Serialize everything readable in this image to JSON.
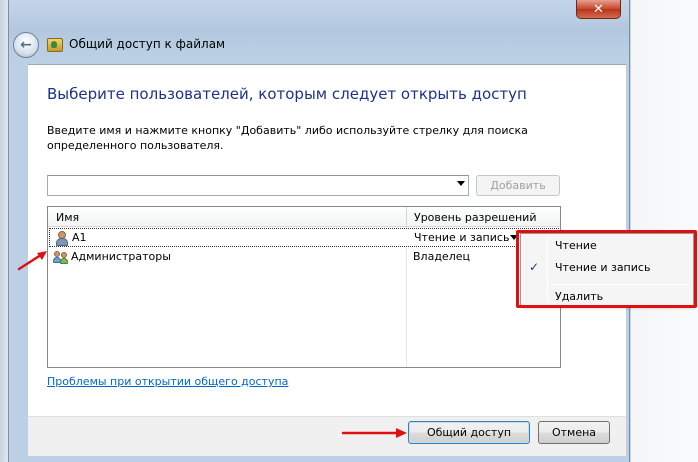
{
  "window": {
    "title": "Общий доступ к файлам",
    "close_label": "✕"
  },
  "main": {
    "heading": "Выберите пользователей, которым следует открыть доступ",
    "instruction": "Введите имя и нажмите кнопку \"Добавить\" либо используйте стрелку для поиска определенного пользователя.",
    "name_input_value": "",
    "add_button": "Добавить"
  },
  "table": {
    "columns": [
      "Имя",
      "Уровень разрешений"
    ],
    "rows": [
      {
        "name": "A1",
        "permission": "Чтение и запись",
        "icon": "user-icon",
        "selected": true
      },
      {
        "name": "Администраторы",
        "permission": "Владелец",
        "icon": "users-group-icon",
        "selected": false
      }
    ]
  },
  "permission_menu": {
    "items": [
      {
        "label": "Чтение",
        "checked": false
      },
      {
        "label": "Чтение и запись",
        "checked": true
      },
      {
        "label": "Удалить",
        "checked": false
      }
    ],
    "check_glyph": "✓"
  },
  "help_link": "Проблемы при открытии общего доступа",
  "footer": {
    "share_button": "Общий доступ",
    "cancel_button": "Отмена"
  },
  "annotation_color": "#e01010"
}
